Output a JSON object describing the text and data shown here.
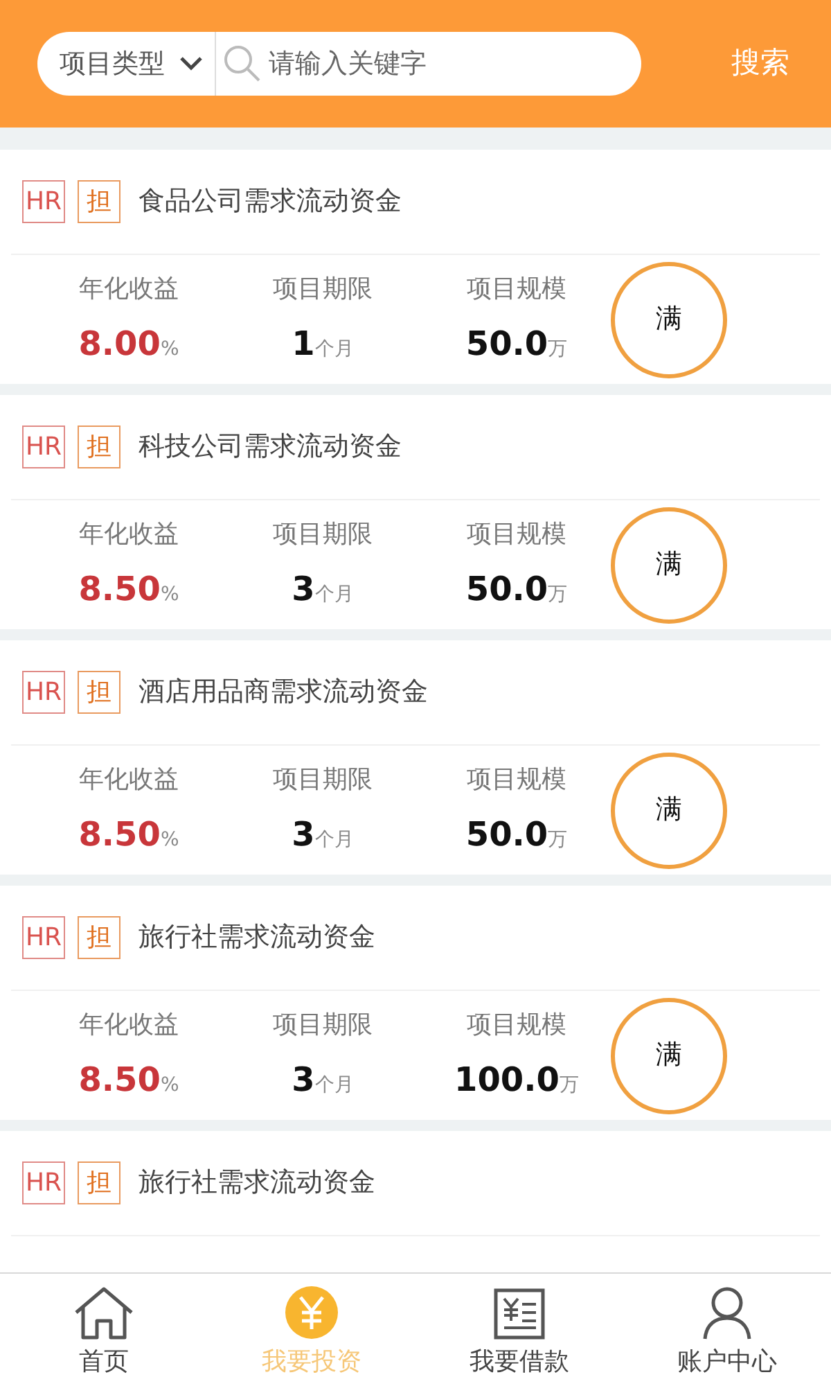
{
  "search_bar": {
    "category": "项目类型",
    "placeholder": "请输入关键字",
    "button": "搜索"
  },
  "projects": [
    {
      "tags": [
        "HR",
        "担"
      ],
      "title": "食品公司需求流动资金",
      "stats": [
        {
          "label": "年化收益",
          "value": "8.00",
          "unit": "%",
          "kind": "rate"
        },
        {
          "label": "项目期限",
          "value": "1",
          "unit": "个月",
          "kind": "plain"
        },
        {
          "label": "项目规模",
          "value": "50.0",
          "unit": "万",
          "kind": "plain"
        }
      ],
      "status": "满"
    },
    {
      "tags": [
        "HR",
        "担"
      ],
      "title": "科技公司需求流动资金",
      "stats": [
        {
          "label": "年化收益",
          "value": "8.50",
          "unit": "%",
          "kind": "rate"
        },
        {
          "label": "项目期限",
          "value": "3",
          "unit": "个月",
          "kind": "plain"
        },
        {
          "label": "项目规模",
          "value": "50.0",
          "unit": "万",
          "kind": "plain"
        }
      ],
      "status": "满"
    },
    {
      "tags": [
        "HR",
        "担"
      ],
      "title": "酒店用品商需求流动资金",
      "stats": [
        {
          "label": "年化收益",
          "value": "8.50",
          "unit": "%",
          "kind": "rate"
        },
        {
          "label": "项目期限",
          "value": "3",
          "unit": "个月",
          "kind": "plain"
        },
        {
          "label": "项目规模",
          "value": "50.0",
          "unit": "万",
          "kind": "plain"
        }
      ],
      "status": "满"
    },
    {
      "tags": [
        "HR",
        "担"
      ],
      "title": "旅行社需求流动资金",
      "stats": [
        {
          "label": "年化收益",
          "value": "8.50",
          "unit": "%",
          "kind": "rate"
        },
        {
          "label": "项目期限",
          "value": "3",
          "unit": "个月",
          "kind": "plain"
        },
        {
          "label": "项目规模",
          "value": "100.0",
          "unit": "万",
          "kind": "plain"
        }
      ],
      "status": "满"
    },
    {
      "tags": [
        "HR",
        "担"
      ],
      "title": "旅行社需求流动资金"
    }
  ],
  "tab_bar": [
    {
      "label": "首页",
      "kind": "home",
      "selected": false
    },
    {
      "label": "我要投资",
      "kind": "invest",
      "selected": true
    },
    {
      "label": "我要借款",
      "kind": "borrow",
      "selected": false
    },
    {
      "label": "账户中心",
      "kind": "account",
      "selected": false
    }
  ]
}
